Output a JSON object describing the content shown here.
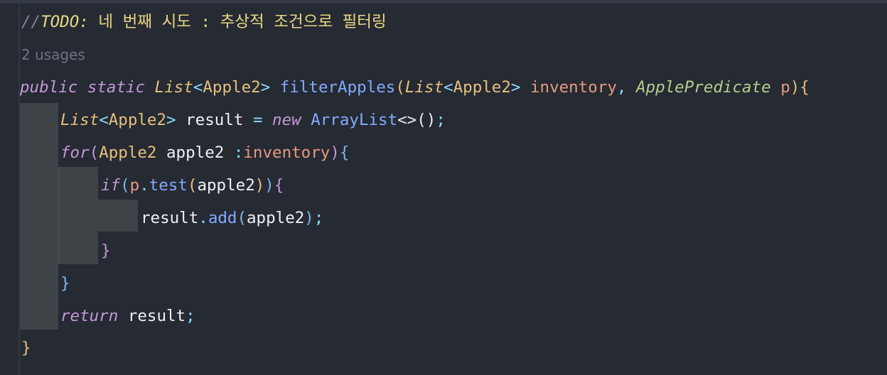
{
  "comment": {
    "slashes": "//",
    "todo": "TODO:",
    "text": " 네 번째 시도 : 추상적 조건으로 필터링"
  },
  "usage_hint": "2 usages",
  "code": {
    "l1": {
      "public": "public",
      "static": "static",
      "list": "List",
      "lt1": "<",
      "apple1": "Apple2",
      "gt1": ">",
      "method": "filterApples",
      "paren_open": "(",
      "list2": "List",
      "lt2": "<",
      "apple2": "Apple2",
      "gt2": ">",
      "inventory": "inventory",
      "comma": ",",
      "predicate": "ApplePredicate",
      "p": "p",
      "paren_close": ")",
      "brace": "{"
    },
    "l2": {
      "list": "List",
      "lt": "<",
      "apple": "Apple2",
      "gt": ">",
      "result": "result",
      "eq": "=",
      "new": "new",
      "arraylist": "ArrayList",
      "diamond": "<>",
      "parens": "()",
      "semi": ";"
    },
    "l3": {
      "for": "for",
      "paren_open": "(",
      "type": "Apple2",
      "var": "apple2",
      "colon": ":",
      "inventory": "inventory",
      "paren_close": ")",
      "brace": "{"
    },
    "l4": {
      "if": "if",
      "paren_open": "(",
      "p": "p",
      "dot": ".",
      "test": "test",
      "inner_open": "(",
      "arg": "apple2",
      "inner_close": ")",
      "paren_close": ")",
      "brace": "{"
    },
    "l5": {
      "result": "result",
      "dot": ".",
      "add": "add",
      "paren_open": "(",
      "arg": "apple2",
      "paren_close": ")",
      "semi": ";"
    },
    "l6": {
      "brace": "}"
    },
    "l7": {
      "brace": "}"
    },
    "l8": {
      "return": "return",
      "result": "result",
      "semi": ";"
    },
    "l9": {
      "brace": "}"
    }
  },
  "colors": {
    "background": "#262a33",
    "indent_block": "#3d4347",
    "keyword": "#c397d8",
    "type": "#e5c07b",
    "function": "#82aaff",
    "parameter": "#e59a7e",
    "todo": "#e9d884"
  }
}
